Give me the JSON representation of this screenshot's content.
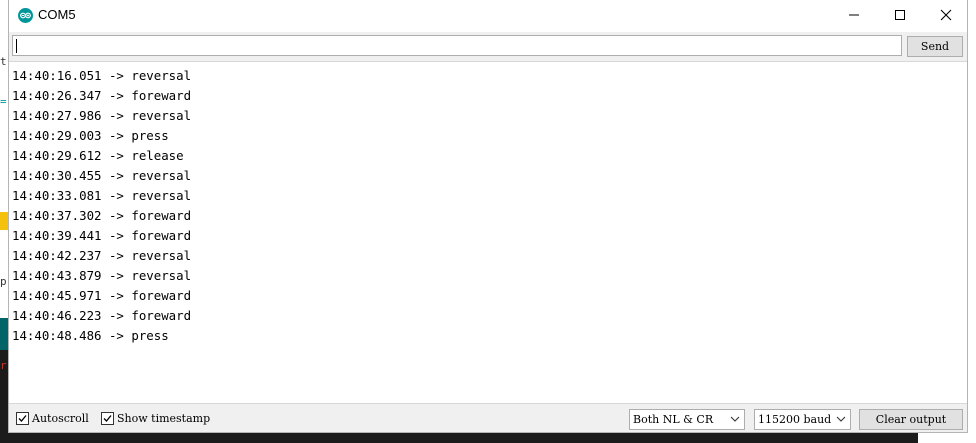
{
  "window": {
    "title": "COM5",
    "minimize_glyph": "—",
    "maximize_glyph": "☐",
    "close_glyph": "✕"
  },
  "send_bar": {
    "input_value": "",
    "send_label": "Send"
  },
  "output": {
    "lines": [
      "14:40:16.051 -> reversal",
      "14:40:26.347 -> foreward",
      "14:40:27.986 -> reversal",
      "14:40:29.003 -> press",
      "14:40:29.612 -> release",
      "14:40:30.455 -> reversal",
      "14:40:33.081 -> reversal",
      "14:40:37.302 -> foreward",
      "14:40:39.441 -> foreward",
      "14:40:42.237 -> reversal",
      "14:40:43.879 -> reversal",
      "14:40:45.971 -> foreward",
      "14:40:46.223 -> foreward",
      "14:40:48.486 -> press"
    ]
  },
  "bottom_bar": {
    "autoscroll_label": "Autoscroll",
    "autoscroll_checked": true,
    "timestamp_label": "Show timestamp",
    "timestamp_checked": true,
    "line_ending_value": "Both NL & CR",
    "baud_value": "115200 baud",
    "clear_label": "Clear output"
  },
  "colors": {
    "app_icon": "#00979c",
    "bar_background": "#f0f0f0",
    "button_background": "#e1e1e1"
  },
  "icons": {
    "app": "arduino-icon",
    "minimize": "minimize-icon",
    "maximize": "maximize-icon",
    "close": "close-icon",
    "dropdown": "chevron-down-icon",
    "check": "checkmark-icon"
  }
}
